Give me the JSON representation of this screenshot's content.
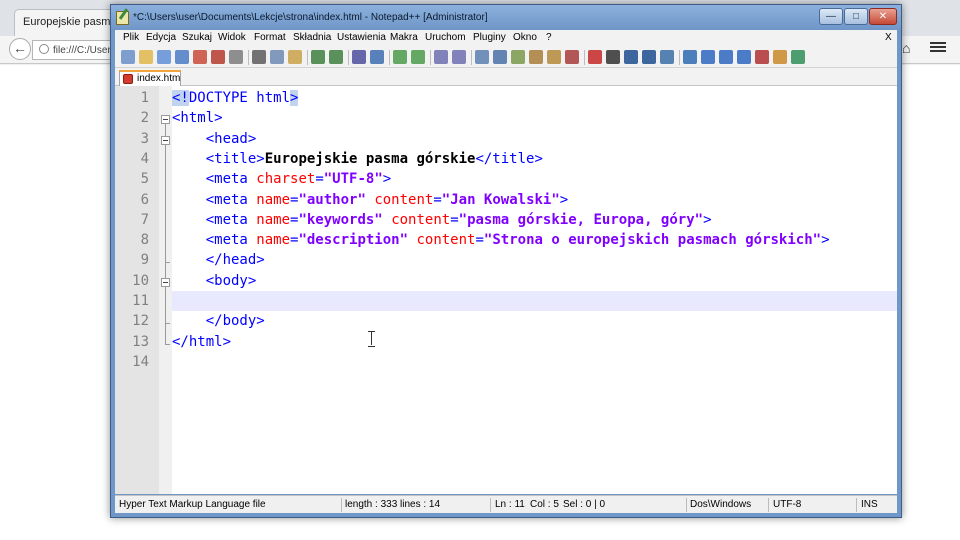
{
  "browser": {
    "tab_title": "Europejskie pasma górskie",
    "url": "file:///C:/Users/user/Documents/Lekcje/strona/index.html"
  },
  "window": {
    "title": "*C:\\Users\\user\\Documents\\Lekcje\\strona\\index.html - Notepad++ [Administrator]",
    "close_glyph": "✕",
    "max_glyph": "□",
    "min_glyph": "—"
  },
  "menu": {
    "items": [
      "Plik",
      "Edycja",
      "Szukaj",
      "Widok",
      "Format",
      "Składnia",
      "Ustawienia",
      "Makra",
      "Uruchom",
      "Pluginy",
      "Okno",
      "?"
    ],
    "close_doc": "X"
  },
  "toolbar": {
    "icons": [
      "new-file-icon",
      "open-file-icon",
      "save-icon",
      "save-all-icon",
      "close-icon",
      "close-all-icon",
      "print-icon",
      "cut-icon",
      "copy-icon",
      "paste-icon",
      "undo-icon",
      "redo-icon",
      "find-icon",
      "replace-icon",
      "zoom-in-icon",
      "zoom-out-icon",
      "sync-vertical-icon",
      "sync-horizontal-icon",
      "word-wrap-icon",
      "show-all-chars-icon",
      "indent-guide-icon",
      "user-lang-icon",
      "doc-map-icon",
      "function-list-icon",
      "record-macro-icon",
      "stop-record-icon",
      "play-macro-icon",
      "play-multiple-icon",
      "save-macro-icon",
      "fold-all-icon",
      "prev-bookmark-icon",
      "next-bookmark-icon",
      "toggle-bookmark-icon",
      "spellcheck-icon",
      "compare-icon",
      "check-icon"
    ]
  },
  "document_tab": {
    "label": "index.html"
  },
  "editor": {
    "current_line": 11,
    "lines": [
      [
        {
          "t": "<!",
          "c": "dt-sel"
        },
        {
          "t": "DOCTYPE html",
          "c": "tag"
        },
        {
          "t": ">",
          "c": "dt-sel"
        }
      ],
      [
        {
          "t": "<html>",
          "c": "tag"
        }
      ],
      [
        {
          "t": "    ",
          "c": ""
        },
        {
          "t": "<head>",
          "c": "tag"
        }
      ],
      [
        {
          "t": "    ",
          "c": ""
        },
        {
          "t": "<title>",
          "c": "tag"
        },
        {
          "t": "Europejskie pasma górskie",
          "c": "txt"
        },
        {
          "t": "</title>",
          "c": "tag"
        }
      ],
      [
        {
          "t": "    ",
          "c": ""
        },
        {
          "t": "<meta ",
          "c": "tag"
        },
        {
          "t": "charset",
          "c": "attr"
        },
        {
          "t": "=",
          "c": "tag"
        },
        {
          "t": "\"UTF-8\"",
          "c": "val"
        },
        {
          "t": ">",
          "c": "tag"
        }
      ],
      [
        {
          "t": "    ",
          "c": ""
        },
        {
          "t": "<meta ",
          "c": "tag"
        },
        {
          "t": "name",
          "c": "attr"
        },
        {
          "t": "=",
          "c": "tag"
        },
        {
          "t": "\"author\"",
          "c": "val"
        },
        {
          "t": " ",
          "c": ""
        },
        {
          "t": "content",
          "c": "attr"
        },
        {
          "t": "=",
          "c": "tag"
        },
        {
          "t": "\"Jan Kowalski\"",
          "c": "val"
        },
        {
          "t": ">",
          "c": "tag"
        }
      ],
      [
        {
          "t": "    ",
          "c": ""
        },
        {
          "t": "<meta ",
          "c": "tag"
        },
        {
          "t": "name",
          "c": "attr"
        },
        {
          "t": "=",
          "c": "tag"
        },
        {
          "t": "\"keywords\"",
          "c": "val"
        },
        {
          "t": " ",
          "c": ""
        },
        {
          "t": "content",
          "c": "attr"
        },
        {
          "t": "=",
          "c": "tag"
        },
        {
          "t": "\"pasma górskie, Europa, góry\"",
          "c": "val"
        },
        {
          "t": ">",
          "c": "tag"
        }
      ],
      [
        {
          "t": "    ",
          "c": ""
        },
        {
          "t": "<meta ",
          "c": "tag"
        },
        {
          "t": "name",
          "c": "attr"
        },
        {
          "t": "=",
          "c": "tag"
        },
        {
          "t": "\"description\"",
          "c": "val"
        },
        {
          "t": " ",
          "c": ""
        },
        {
          "t": "content",
          "c": "attr"
        },
        {
          "t": "=",
          "c": "tag"
        },
        {
          "t": "\"Strona o europejskich pasmach górskich\"",
          "c": "val"
        },
        {
          "t": ">",
          "c": "tag"
        }
      ],
      [
        {
          "t": "    ",
          "c": ""
        },
        {
          "t": "</head>",
          "c": "tag"
        }
      ],
      [
        {
          "t": "    ",
          "c": ""
        },
        {
          "t": "<body>",
          "c": "tag"
        }
      ],
      [
        {
          "t": "",
          "c": ""
        }
      ],
      [
        {
          "t": "    ",
          "c": ""
        },
        {
          "t": "</body>",
          "c": "tag"
        }
      ],
      [
        {
          "t": "</html>",
          "c": "tag"
        }
      ],
      [
        {
          "t": "",
          "c": ""
        }
      ]
    ]
  },
  "status": {
    "file_type": "Hyper Text Markup Language file",
    "length": "length : 333",
    "lines": "lines : 14",
    "ln": "Ln : 11",
    "col": "Col : 5",
    "sel": "Sel : 0 | 0",
    "eol": "Dos\\Windows",
    "encoding": "UTF-8",
    "mode": "INS"
  },
  "colors": {
    "tag": "#0000ff",
    "attribute": "#ff0000",
    "value": "#8000ff",
    "current_line": "#e8e8ff",
    "title_bar": "#7aa0d0"
  }
}
